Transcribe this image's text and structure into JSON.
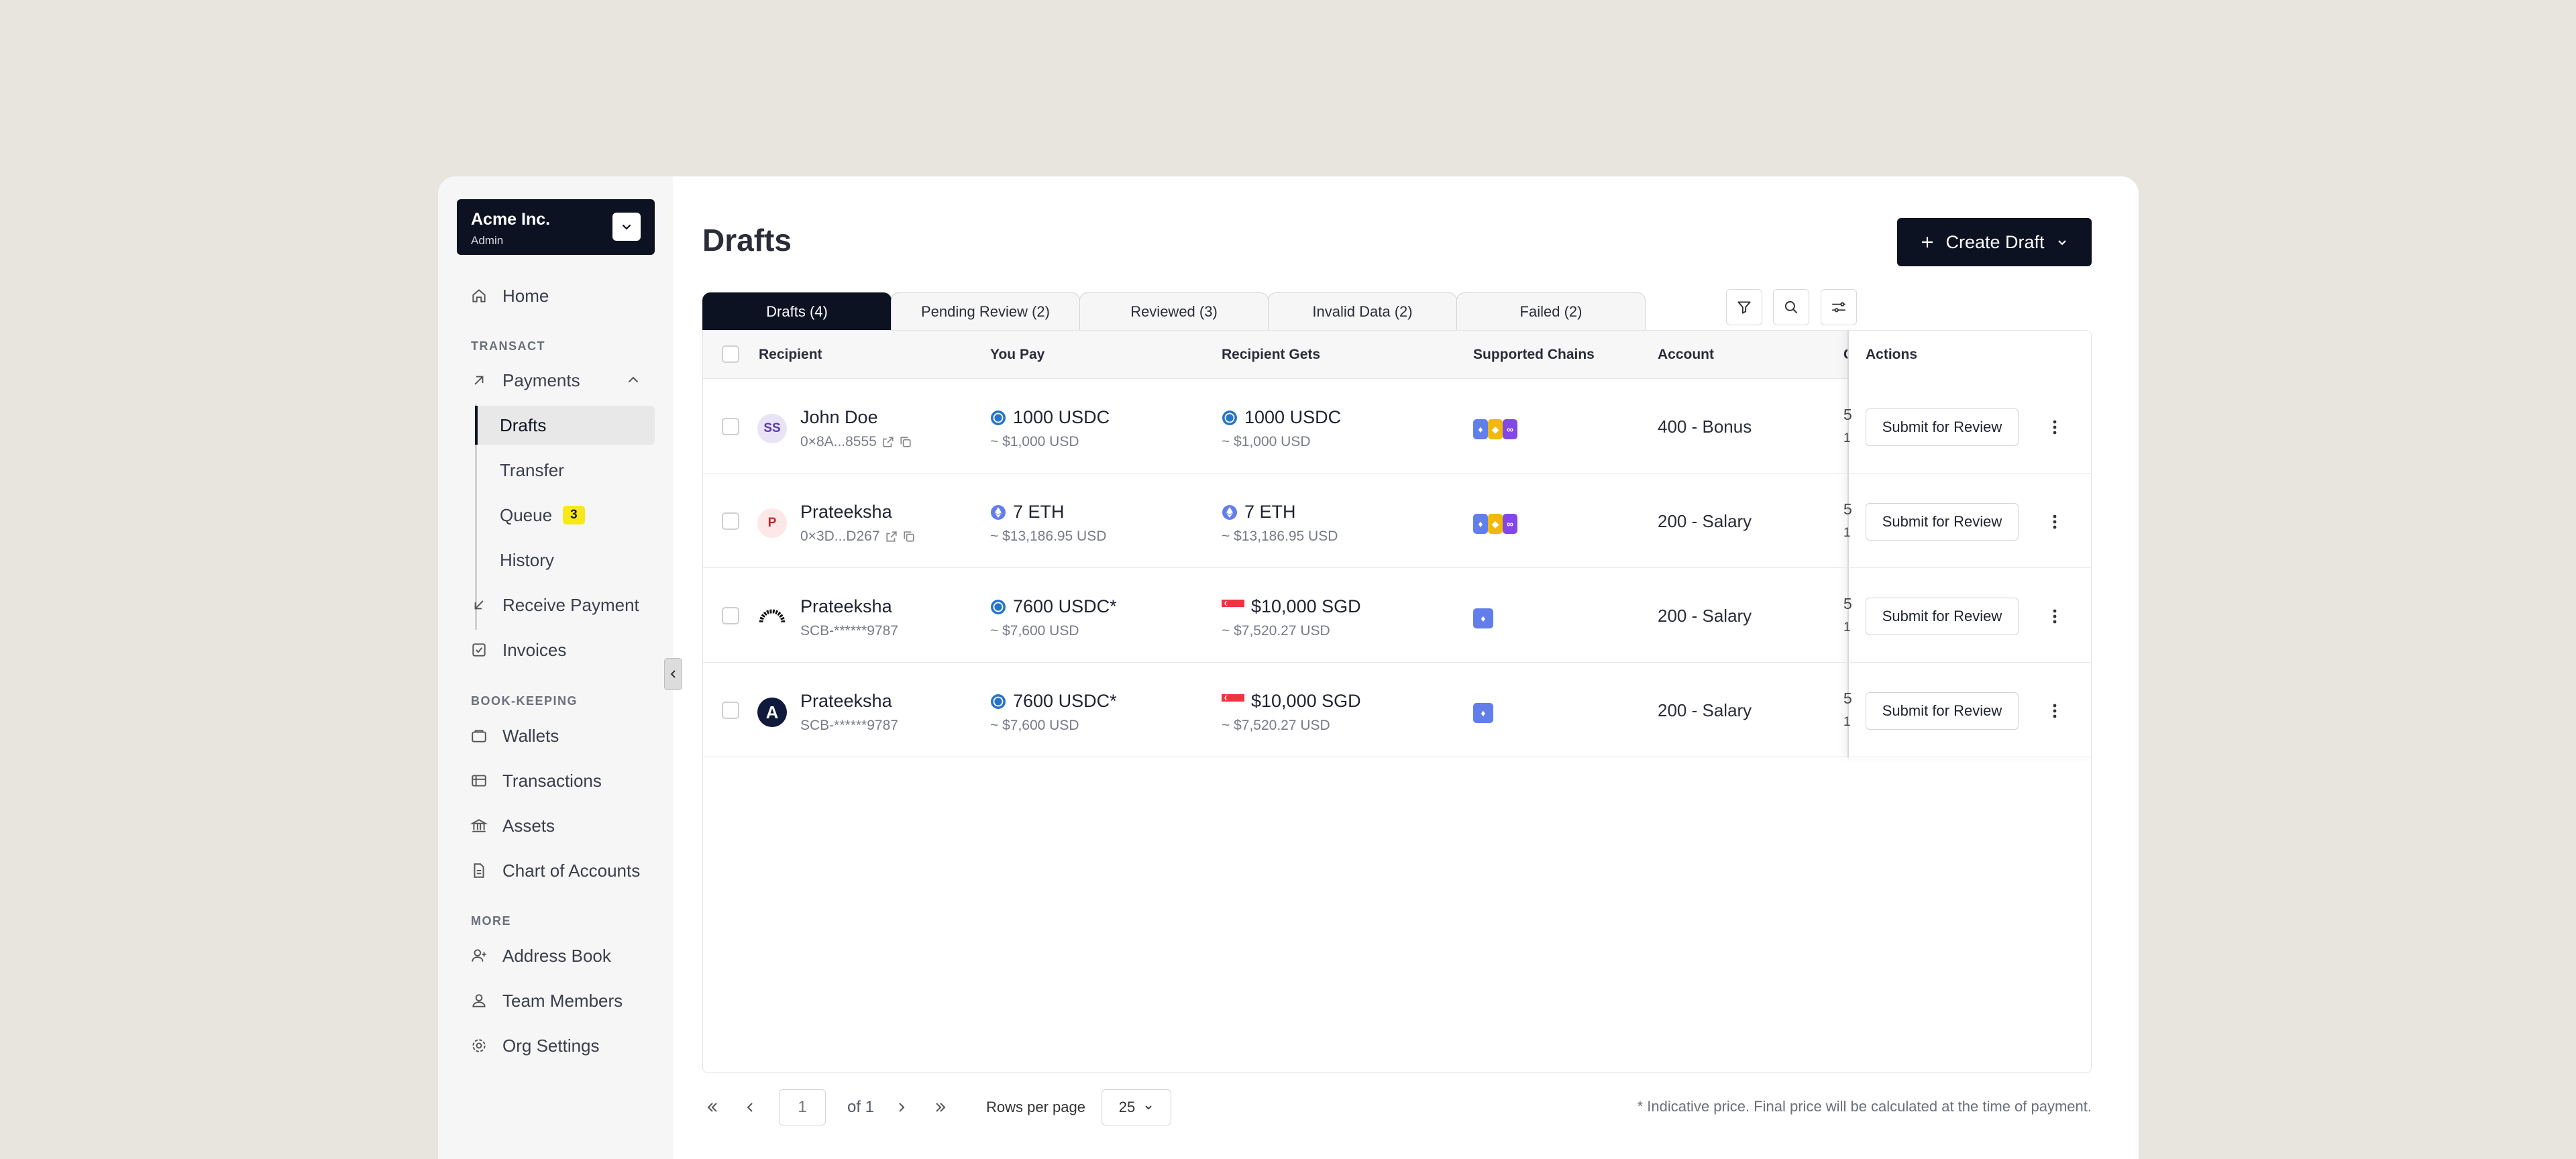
{
  "org": {
    "name": "Acme Inc.",
    "role": "Admin"
  },
  "nav": {
    "home": "Home",
    "section_transact": "TRANSACT",
    "payments": "Payments",
    "drafts": "Drafts",
    "transfer": "Transfer",
    "queue": "Queue",
    "queue_count": "3",
    "history": "History",
    "receive_payment": "Receive Payment",
    "invoices": "Invoices",
    "section_bookkeeping": "BOOK-KEEPING",
    "wallets": "Wallets",
    "transactions": "Transactions",
    "assets": "Assets",
    "chart_of_accounts": "Chart of Accounts",
    "section_more": "MORE",
    "address_book": "Address Book",
    "team_members": "Team Members",
    "org_settings": "Org Settings"
  },
  "page": {
    "title": "Drafts",
    "create_label": "Create Draft"
  },
  "tabs": [
    {
      "label": "Drafts (4)",
      "active": true
    },
    {
      "label": "Pending Review (2)"
    },
    {
      "label": "Reviewed (3)"
    },
    {
      "label": "Invalid Data (2)"
    },
    {
      "label": "Failed (2)"
    }
  ],
  "table": {
    "columns": {
      "recipient": "Recipient",
      "you_pay": "You Pay",
      "recipient_gets": "Recipient Gets",
      "supported_chains": "Supported Chains",
      "account": "Account",
      "cut": "C",
      "actions": "Actions"
    },
    "rows": [
      {
        "avatar": "SS",
        "name": "John Doe",
        "address": "0×8A...8555",
        "pay": "1000 USDC",
        "pay_usd": "~ $1,000 USD",
        "gets": "1000 USDC",
        "gets_usd": "~ $1,000 USD",
        "account": "400 - Bonus",
        "cut1": "5",
        "cut2": "1",
        "action": "Submit for Review"
      },
      {
        "avatar": "P",
        "name": "Prateeksha",
        "address": "0×3D...D267",
        "pay": "7 ETH",
        "pay_usd": "~ $13,186.95 USD",
        "gets": "7 ETH",
        "gets_usd": "~ $13,186.95 USD",
        "account": "200 - Salary",
        "cut1": "5",
        "cut2": "1",
        "action": "Submit for Review"
      },
      {
        "avatar": "",
        "name": "Prateeksha",
        "address": "SCB-******9787",
        "pay": "7600 USDC*",
        "pay_usd": "~ $7,600 USD",
        "gets": "$10,000 SGD",
        "gets_usd": "~ $7,520.27 USD",
        "account": "200 - Salary",
        "cut1": "5",
        "cut2": "1",
        "action": "Submit for Review"
      },
      {
        "avatar": "A",
        "name": "Prateeksha",
        "address": "SCB-******9787",
        "pay": "7600 USDC*",
        "pay_usd": "~ $7,600 USD",
        "gets": "$10,000 SGD",
        "gets_usd": "~ $7,520.27 USD",
        "account": "200 - Salary",
        "cut1": "5",
        "cut2": "1",
        "action": "Submit for Review"
      }
    ]
  },
  "pagination": {
    "page": "1",
    "of": "of 1",
    "rows_label": "Rows per page",
    "rows_value": "25"
  },
  "footnote": "* Indicative price. Final price will be calculated at the time of payment.",
  "colors": {
    "primary": "#0d1222",
    "badge": "#f7e81a",
    "background": "#e8e4de"
  }
}
